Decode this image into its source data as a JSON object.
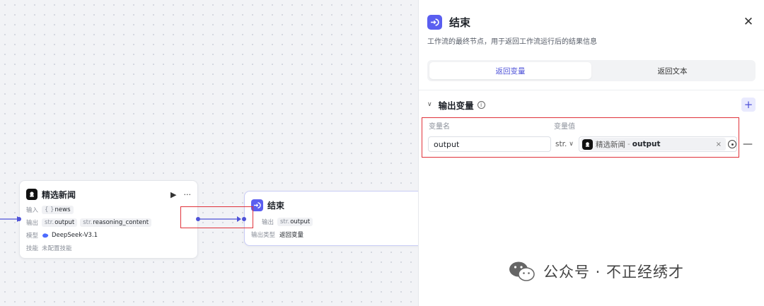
{
  "nodes": {
    "news": {
      "title": "精选新闻",
      "run_icon": "▶",
      "more_icon": "···",
      "input_label": "输入",
      "input_tag_prefix": "{ }",
      "input_tag": "news",
      "output_label": "输出",
      "output_tags": [
        {
          "prefix": "str.",
          "name": "output"
        },
        {
          "prefix": "str.",
          "name": "reasoning_content"
        }
      ],
      "model_label": "模型",
      "model_value": "DeepSeek-V3.1",
      "skill_label": "技能",
      "skill_value": "未配置技能"
    },
    "end": {
      "title": "结束",
      "output_label": "输出",
      "output_tag_prefix": "str.",
      "output_tag": "output",
      "output_type_label": "输出类型",
      "output_type_value": "返回变量"
    }
  },
  "panel": {
    "title": "结束",
    "description": "工作流的最终节点，用于返回工作流运行后的结果信息",
    "tabs": [
      {
        "label": "返回变量",
        "active": true
      },
      {
        "label": "返回文本",
        "active": false
      }
    ],
    "section_title": "输出变量",
    "add_label": "+",
    "col_name_label": "变量名",
    "col_value_label": "变量值",
    "variable": {
      "name": "output",
      "type": "str.",
      "source": "精选新闻",
      "separator": "-",
      "var": "output",
      "clear": "×"
    },
    "remove_label": "—"
  },
  "watermark": {
    "text": "公众号 · 不正经绣才"
  },
  "colors": {
    "accent": "#4e52d8",
    "highlight_red": "#e0323a",
    "end_node_icon": "#5a5ef0"
  }
}
